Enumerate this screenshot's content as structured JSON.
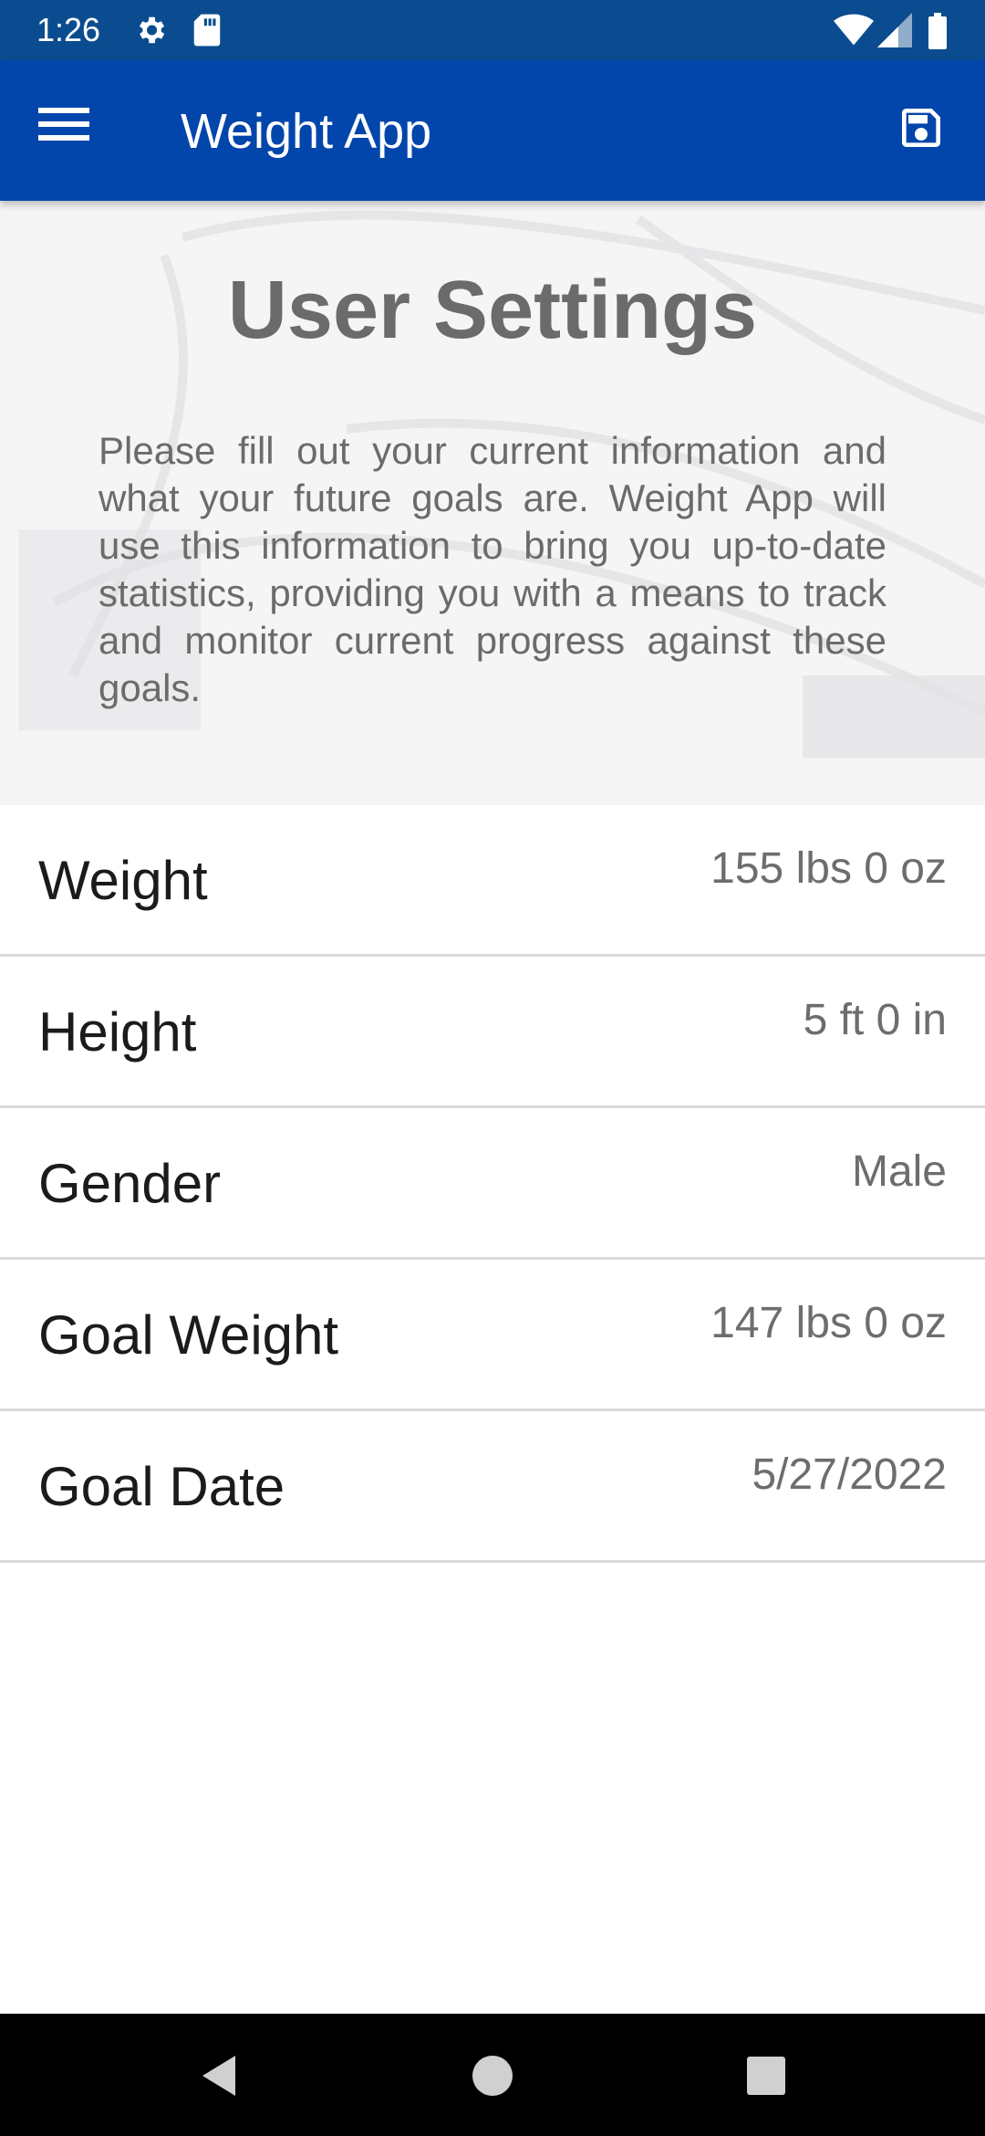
{
  "status_bar": {
    "time": "1:26",
    "icons": [
      "gear-icon",
      "sd-card-icon",
      "wifi-icon",
      "signal-icon",
      "battery-icon"
    ]
  },
  "app_bar": {
    "title": "Weight App",
    "menu_icon": "hamburger-menu-icon",
    "action_icon": "save-icon"
  },
  "hero": {
    "title": "User Settings",
    "description": "Please fill out your current information and what your future goals are. Weight App will use this information to bring you up-to-date statistics, providing you with a means to track and monitor current progress against these goals."
  },
  "settings": [
    {
      "label": "Weight",
      "value": "155 lbs 0 oz"
    },
    {
      "label": "Height",
      "value": "5 ft 0 in"
    },
    {
      "label": "Gender",
      "value": "Male"
    },
    {
      "label": "Goal Weight",
      "value": "147 lbs 0 oz"
    },
    {
      "label": "Goal Date",
      "value": "5/27/2022"
    }
  ],
  "nav_bar": {
    "buttons": [
      "back-icon",
      "home-icon",
      "recents-icon"
    ]
  },
  "colors": {
    "status_bar": "#0a4c8f",
    "app_bar": "#0246ab",
    "hero_background": "#f5f5f6",
    "text_muted": "#6b6b6b",
    "divider": "#d9d9d9"
  }
}
